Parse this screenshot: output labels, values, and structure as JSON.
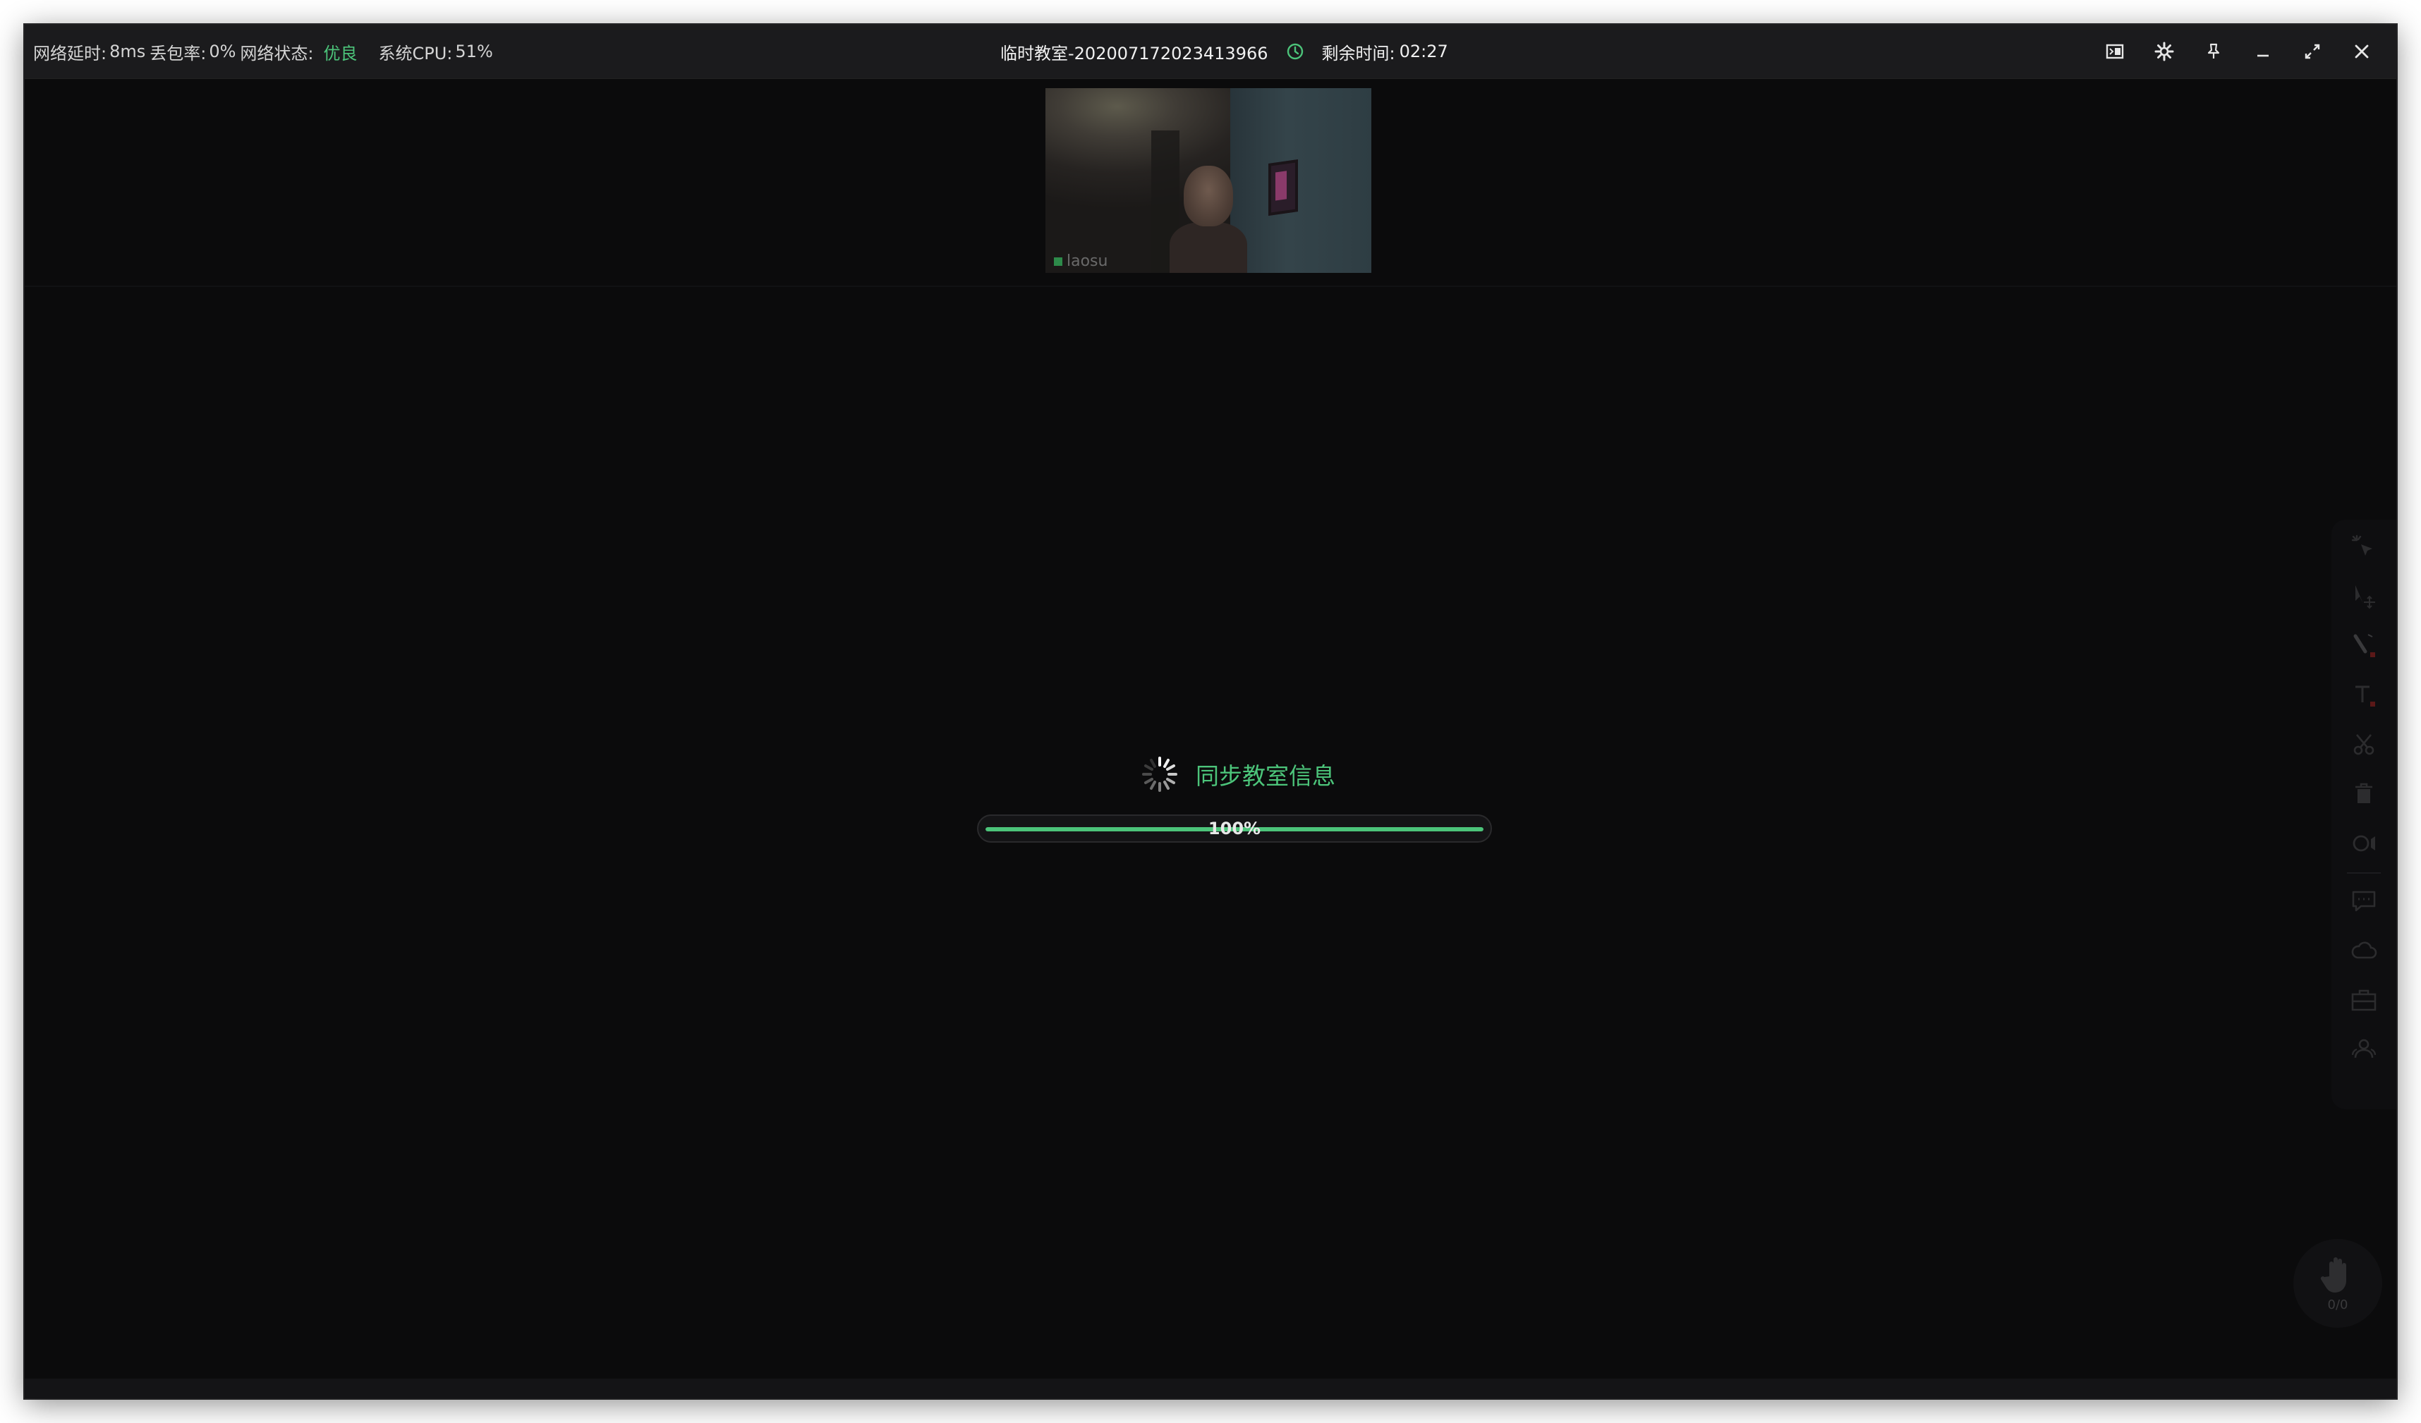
{
  "status": {
    "latency_label": "网络延时:",
    "latency_value": "8ms",
    "loss_label": "丢包率:",
    "loss_value": "0%",
    "network_label": "网络状态:",
    "network_value": "优良",
    "cpu_label": "系统CPU:",
    "cpu_value": "51%"
  },
  "header": {
    "room_title": "临时教室-20200717202341396​6",
    "remaining_label": "剩余时间:",
    "remaining_value": "02:27"
  },
  "window_controls": [
    "picture-in-picture-icon",
    "gear-icon",
    "pin-icon",
    "minimize-icon",
    "restore-icon",
    "close-icon"
  ],
  "video": {
    "participant_name": "laosu"
  },
  "loading": {
    "message": "同步教室信息",
    "progress": 100,
    "progress_label": "100%"
  },
  "toolbar": {
    "tools": [
      "laser-pointer-icon",
      "select-move-icon",
      "pen-icon",
      "text-icon",
      "scissors-icon",
      "trash-icon",
      "record-icon",
      "chat-icon",
      "cloud-icon",
      "toolbox-icon",
      "users-icon"
    ]
  },
  "hand_raise": {
    "count": "0/0"
  },
  "colors": {
    "accent": "#4cc47a",
    "background": "#0b0b0c",
    "titlebar": "#1b1b1d"
  }
}
